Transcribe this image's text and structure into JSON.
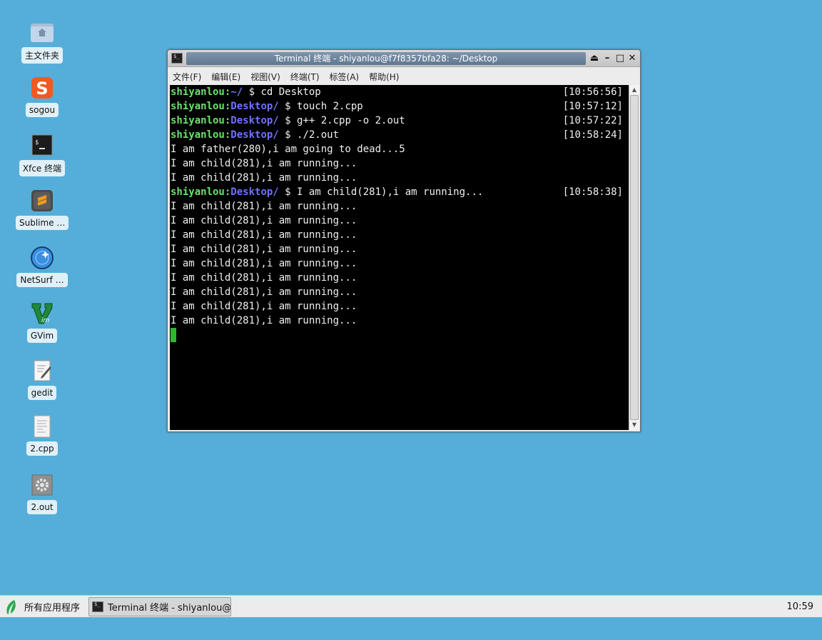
{
  "desktop": {
    "icons": [
      {
        "label": "主文件夹",
        "icon": "home-folder-icon"
      },
      {
        "label": "sogou",
        "icon": "sogou-icon"
      },
      {
        "label": "Xfce 终端",
        "icon": "terminal-icon"
      },
      {
        "label": "Sublime …",
        "icon": "sublime-text-icon"
      },
      {
        "label": "NetSurf …",
        "icon": "netsurf-globe-icon"
      },
      {
        "label": "GVim",
        "icon": "gvim-icon"
      },
      {
        "label": "gedit",
        "icon": "gedit-icon"
      },
      {
        "label": "2.cpp",
        "icon": "text-file-icon"
      },
      {
        "label": "2.out",
        "icon": "executable-gear-icon"
      }
    ]
  },
  "window": {
    "title": "Terminal 终端 - shiyanlou@f7f8357bfa28: ~/Desktop",
    "controls": {
      "shade": "⏏",
      "minimize": "–",
      "maximize": "□",
      "close": "✕"
    },
    "menu": [
      "文件(F)",
      "编辑(E)",
      "视图(V)",
      "终端(T)",
      "标签(A)",
      "帮助(H)"
    ]
  },
  "terminal": {
    "user": "shiyanlou",
    "sep": ":",
    "lines": [
      {
        "kind": "prompt",
        "path": "~/",
        "cmd": " $ cd Desktop",
        "ts": "[10:56:56]"
      },
      {
        "kind": "prompt",
        "path": "Desktop/",
        "cmd": " $ touch 2.cpp",
        "ts": "[10:57:12]"
      },
      {
        "kind": "prompt",
        "path": "Desktop/",
        "cmd": " $ g++ 2.cpp -o 2.out",
        "ts": "[10:57:22]"
      },
      {
        "kind": "prompt",
        "path": "Desktop/",
        "cmd": " $ ./2.out",
        "ts": "[10:58:24]"
      },
      {
        "kind": "out",
        "text": "I am father(280),i am going to dead...5"
      },
      {
        "kind": "out",
        "text": "I am child(281),i am running..."
      },
      {
        "kind": "out",
        "text": "I am child(281),i am running..."
      },
      {
        "kind": "prompt",
        "path": "Desktop/",
        "cmd": " $ I am child(281),i am running...",
        "ts": "[10:58:38]"
      },
      {
        "kind": "out",
        "text": "I am child(281),i am running..."
      },
      {
        "kind": "out",
        "text": "I am child(281),i am running..."
      },
      {
        "kind": "out",
        "text": "I am child(281),i am running..."
      },
      {
        "kind": "out",
        "text": "I am child(281),i am running..."
      },
      {
        "kind": "out",
        "text": "I am child(281),i am running..."
      },
      {
        "kind": "out",
        "text": "I am child(281),i am running..."
      },
      {
        "kind": "out",
        "text": "I am child(281),i am running..."
      },
      {
        "kind": "out",
        "text": "I am child(281),i am running..."
      },
      {
        "kind": "out",
        "text": "I am child(281),i am running..."
      }
    ],
    "colors": {
      "user": "#6ae36a",
      "path": "#7272ff",
      "cursor": "#2fb82f",
      "background": "#000000"
    }
  },
  "taskbar": {
    "apps_menu_label": "所有应用程序",
    "task_label": "Terminal 终端 - shiyanlou@f…",
    "clock": "10:59"
  },
  "colors": {
    "desktop": "#55aed9"
  }
}
